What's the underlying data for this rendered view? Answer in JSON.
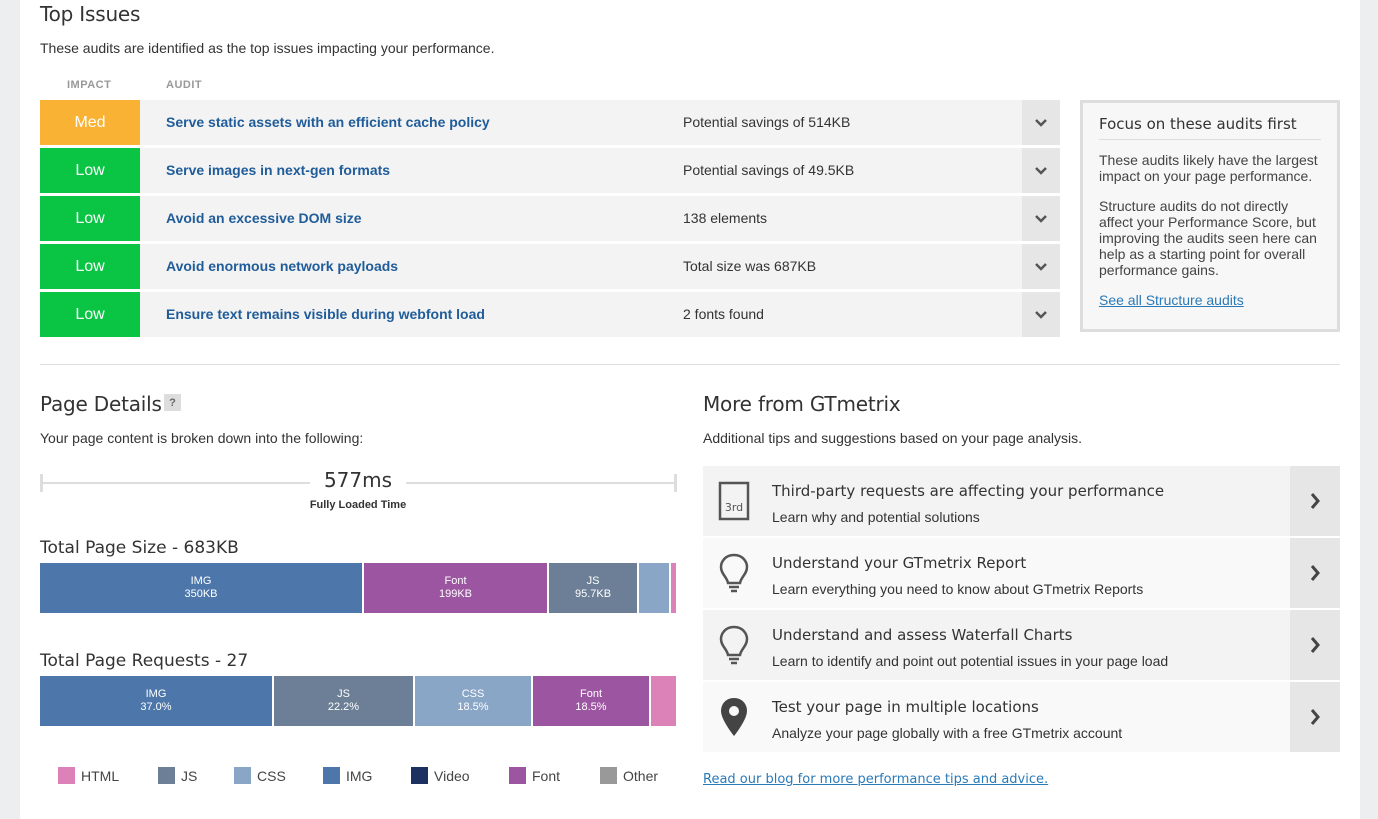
{
  "top_issues": {
    "title": "Top Issues",
    "subtitle": "These audits are identified as the top issues impacting your performance.",
    "col_impact": "IMPACT",
    "col_audit": "AUDIT",
    "rows": [
      {
        "impact": "Med",
        "title": "Serve static assets with an efficient cache policy",
        "desc": "Potential savings of 514KB"
      },
      {
        "impact": "Low",
        "title": "Serve images in next-gen formats",
        "desc": "Potential savings of 49.5KB"
      },
      {
        "impact": "Low",
        "title": "Avoid an excessive DOM size",
        "desc": "138 elements"
      },
      {
        "impact": "Low",
        "title": "Avoid enormous network payloads",
        "desc": "Total size was 687KB"
      },
      {
        "impact": "Low",
        "title": "Ensure text remains visible during webfont load",
        "desc": "2 fonts found"
      }
    ],
    "colors": {
      "med": "#f9b233",
      "low": "#0ac443"
    }
  },
  "focus": {
    "title": "Focus on these audits first",
    "p1": "These audits likely have the largest impact on your page performance.",
    "p2": "Structure audits do not directly affect your Performance Score, but improving the audits seen here can help as a starting point for overall performance gains.",
    "link": "See all Structure audits"
  },
  "page_details": {
    "title": "Page Details",
    "help": "?",
    "subtitle": "Your page content is broken down into the following:",
    "fully_loaded": "577ms",
    "fully_loaded_label": "Fully Loaded Time",
    "size_title": "Total Page Size - 683KB",
    "size_segments": [
      {
        "label": "IMG",
        "value": "350KB",
        "kb": 350,
        "type": "IMG"
      },
      {
        "label": "Font",
        "value": "199KB",
        "kb": 199,
        "type": "Font"
      },
      {
        "label": "JS",
        "value": "95.7KB",
        "kb": 95.7,
        "type": "JS"
      },
      {
        "label": "",
        "value": "",
        "kb": 33,
        "type": "CSS"
      },
      {
        "label": "",
        "value": "",
        "kb": 5.3,
        "type": "HTML"
      }
    ],
    "requests_title": "Total Page Requests - 27",
    "request_segments": [
      {
        "label": "IMG",
        "value": "37.0%",
        "pct": 37.0,
        "type": "IMG"
      },
      {
        "label": "JS",
        "value": "22.2%",
        "pct": 22.2,
        "type": "JS"
      },
      {
        "label": "CSS",
        "value": "18.5%",
        "pct": 18.5,
        "type": "CSS"
      },
      {
        "label": "Font",
        "value": "18.5%",
        "pct": 18.5,
        "type": "Font"
      },
      {
        "label": "",
        "value": "",
        "pct": 3.8,
        "type": "HTML"
      }
    ],
    "legend": [
      {
        "label": "HTML",
        "type": "HTML"
      },
      {
        "label": "JS",
        "type": "JS"
      },
      {
        "label": "CSS",
        "type": "CSS"
      },
      {
        "label": "IMG",
        "type": "IMG"
      },
      {
        "label": "Video",
        "type": "Video"
      },
      {
        "label": "Font",
        "type": "Font"
      },
      {
        "label": "Other",
        "type": "Other"
      }
    ],
    "type_colors": {
      "HTML": "#dc82b8",
      "JS": "#6c7f96",
      "CSS": "#8aa6c6",
      "IMG": "#4d77aa",
      "Video": "#1d3161",
      "Font": "#9c55a0",
      "Other": "#999999"
    }
  },
  "more": {
    "title": "More from GTmetrix",
    "subtitle": "Additional tips and suggestions based on your page analysis.",
    "tips": [
      {
        "icon": "third-party-icon",
        "icon_text": "3rd",
        "title": "Third-party requests are affecting your performance",
        "desc": "Learn why and potential solutions"
      },
      {
        "icon": "lightbulb-icon",
        "title": "Understand your GTmetrix Report",
        "desc": "Learn everything you need to know about GTmetrix Reports"
      },
      {
        "icon": "lightbulb-icon",
        "title": "Understand and assess Waterfall Charts",
        "desc": "Learn to identify and point out potential issues in your page load"
      },
      {
        "icon": "map-pin-icon",
        "title": "Test your page in multiple locations",
        "desc": "Analyze your page globally with a free GTmetrix account"
      }
    ],
    "blog_link": "Read our blog for more performance tips and advice."
  }
}
